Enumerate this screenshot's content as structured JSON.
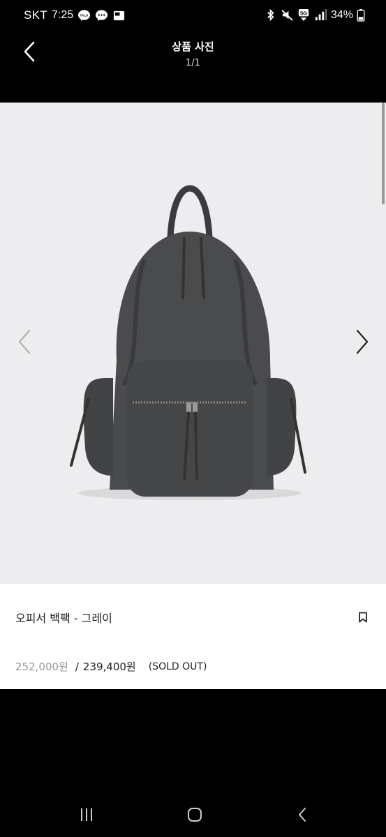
{
  "status_bar": {
    "carrier": "SKT",
    "time": "7:25",
    "talk_badge": "TALK",
    "network": "5G",
    "battery": "34%"
  },
  "header": {
    "title": "상품 사진",
    "counter": "1/1"
  },
  "product": {
    "name": "오피서 백팩 - 그레이",
    "original_price": "252,000원",
    "separator": "/",
    "sale_price": "239,400원",
    "status": "(SOLD OUT)"
  },
  "colors": {
    "background": "#000000",
    "photo_bg": "#ededef",
    "bag": "#4a4b4d"
  },
  "icons": {
    "back": "chevron-left-icon",
    "prev": "chevron-left-icon",
    "next": "chevron-right-icon",
    "bookmark": "bookmark-icon"
  }
}
